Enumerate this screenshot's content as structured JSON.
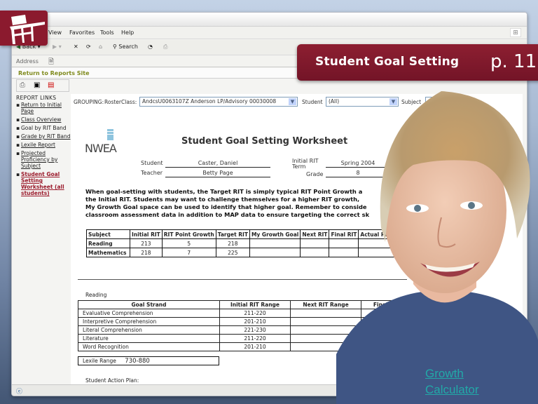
{
  "slide": {
    "banner_title": "Student Goal Setting",
    "page_ref": "p. 11",
    "link_text_line1": "Growth",
    "link_text_line2": "Calculator",
    "brand_color": "#8b1a2e",
    "link_color": "#22a9a8"
  },
  "browser": {
    "menu": [
      "View",
      "Favorites",
      "Tools",
      "Help"
    ],
    "toolbar": {
      "back_label": "Back",
      "search_label": "Search"
    },
    "address_label": "Address",
    "return_link": "Return to Reports Site"
  },
  "sidebar": {
    "heading": "REPORT LINKS",
    "items": [
      {
        "label": "Return to Initial Page",
        "style": "link"
      },
      {
        "label": "Class Overview",
        "style": "link"
      },
      {
        "label": "Goal by RIT Band",
        "style": "plain"
      },
      {
        "label": "Grade by RIT Band",
        "style": "link"
      },
      {
        "label": "Lexile Report",
        "style": "link"
      },
      {
        "label": "Projected Proficiency by Subject",
        "style": "link"
      },
      {
        "label": "Student Goal Setting Worksheet (all students)",
        "style": "active"
      }
    ]
  },
  "filters": {
    "grouping_label": "GROUPING:",
    "roster_label": "RosterClass:",
    "roster_value": "AndcsU0063107Z Anderson LP/Advisory 00030008",
    "student_label": "Student",
    "student_value": "(All)",
    "subject_label": "Subject"
  },
  "worksheet": {
    "logo": "NWEA",
    "title": "Student Goal Setting Worksheet",
    "student_label": "Student",
    "student_value": "Caster, Daniel",
    "teacher_label": "Teacher",
    "teacher_value": "Betty Page",
    "initial_rit_term_label": "Initial RIT Term",
    "initial_rit_term_value": "Spring 2004",
    "grade_label": "Grade",
    "grade_value": "8",
    "intro_lines": [
      "When goal-setting with students, the Target RIT is simply typical RIT Point Growth a",
      "the Initial RIT.  Students may want to challenge themselves for a higher RIT growth,",
      "My Growth Goal space can be used to identify that higher goal.  Remember to conside",
      "classroom assessment data in addition to MAP data to ensure targeting the correct sk"
    ],
    "rit_table": {
      "headers": [
        "Subject",
        "Initial RIT",
        "RIT Point Growth",
        "Target RIT",
        "My Growth Goal",
        "Next RIT",
        "Final RIT",
        "Actual RIT G"
      ],
      "rows": [
        [
          "Reading",
          "213",
          "5",
          "218",
          "",
          "",
          "",
          ""
        ],
        [
          "Mathematics",
          "218",
          "7",
          "225",
          "",
          "",
          "",
          ""
        ]
      ]
    },
    "reading_label": "Reading",
    "strand_table": {
      "headers": [
        "Goal Strand",
        "Initial RIT Range",
        "Next RIT Range",
        "Final RIT Range"
      ],
      "rows": [
        [
          "Evaluative Comprehension",
          "211-220",
          "",
          ""
        ],
        [
          "Interpretive Comprehension",
          "201-210",
          "",
          ""
        ],
        [
          "Literal Comprehension",
          "221-230",
          "",
          ""
        ],
        [
          "Literature",
          "211-220",
          "",
          ""
        ],
        [
          "Word Recognition",
          "201-210",
          "",
          ""
        ]
      ]
    },
    "lexile_label": "Lexile Range",
    "lexile_value": "730-880",
    "action_plan_label": "Student Action Plan:"
  }
}
